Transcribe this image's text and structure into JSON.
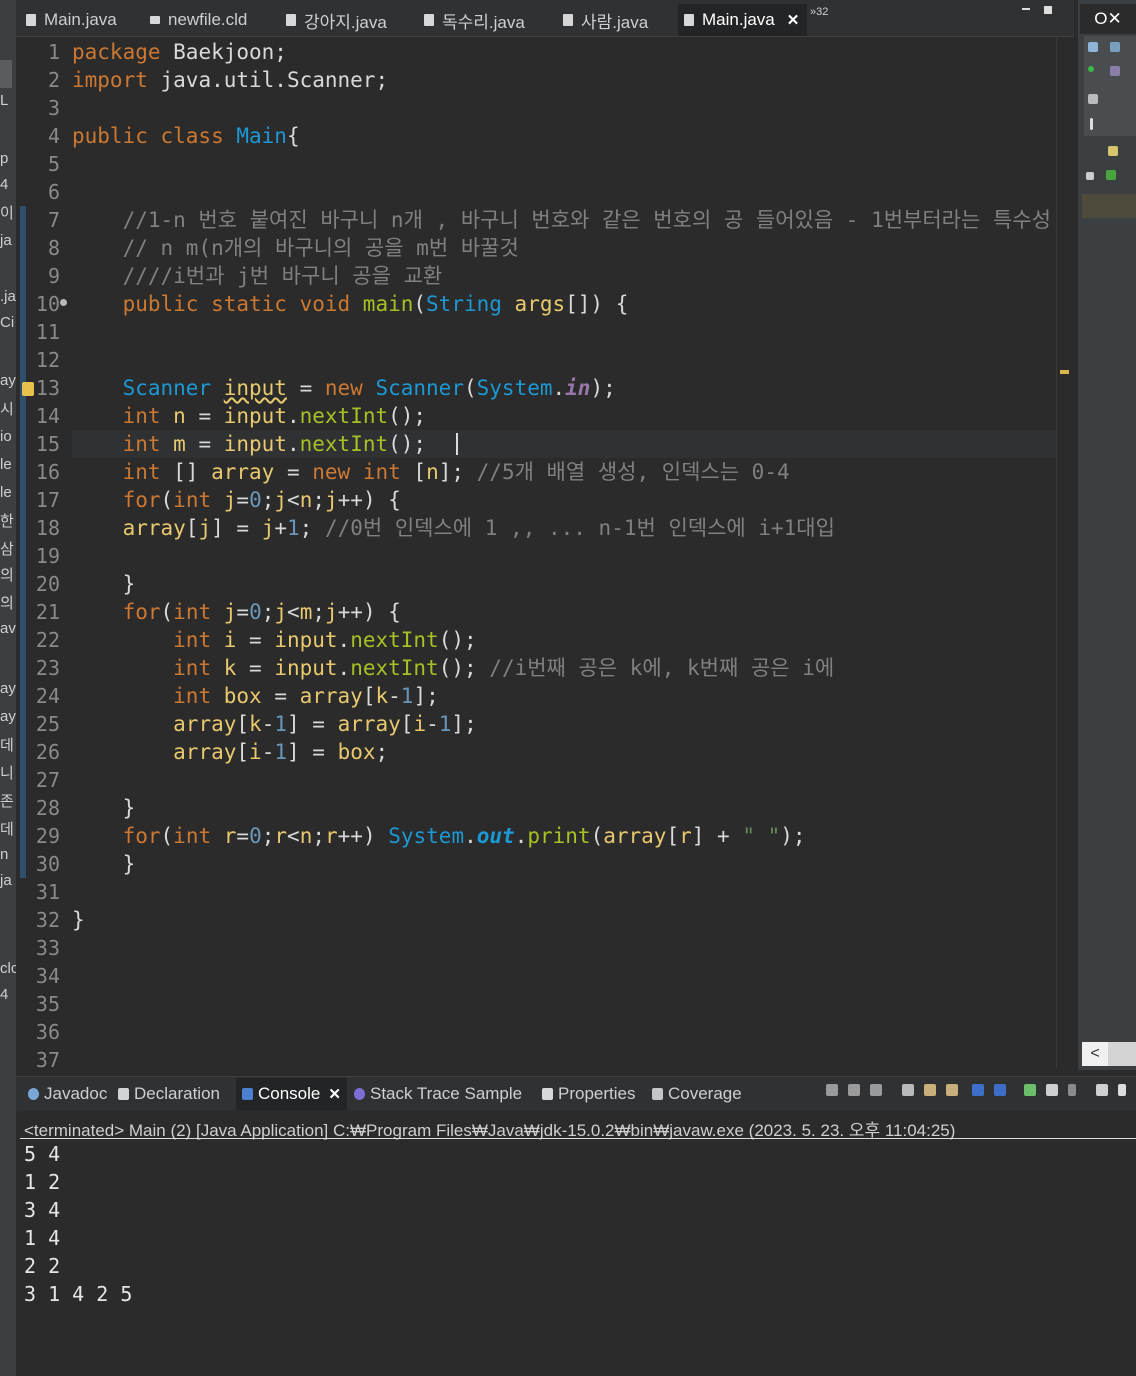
{
  "editor_tabs": [
    {
      "label": "Main.java",
      "icon": "java-file-icon",
      "active": false
    },
    {
      "label": "newfile.cld",
      "icon": "cld-file-icon",
      "active": false
    },
    {
      "label": "강아지.java",
      "icon": "java-file-icon",
      "active": false
    },
    {
      "label": "독수리.java",
      "icon": "java-file-icon",
      "active": false
    },
    {
      "label": "사람.java",
      "icon": "java-file-icon",
      "active": false
    },
    {
      "label": "Main.java",
      "icon": "java-file-icon",
      "active": true,
      "close": "✕"
    }
  ],
  "overflow_label": "»32",
  "right_panel_tab": "O✕",
  "left_fragments": [
    "L",
    "p",
    "4",
    "이",
    "ja",
    ".ja",
    "Ci",
    "ay",
    "시",
    "io",
    "le",
    "le",
    "한",
    "삼",
    "의",
    "의",
    "av",
    "ay",
    "ay",
    "데",
    "니",
    "존",
    "데",
    "n",
    "ja",
    "clc",
    "4"
  ],
  "code_lines": [
    {
      "n": "1",
      "t": [
        [
          "kw",
          "package "
        ],
        [
          "",
          "Baekjoon;"
        ]
      ]
    },
    {
      "n": "2",
      "t": [
        [
          "kw",
          "import "
        ],
        [
          "",
          "java.util.Scanner;"
        ]
      ]
    },
    {
      "n": "3",
      "t": []
    },
    {
      "n": "4",
      "t": [
        [
          "kw",
          "public class "
        ],
        [
          "typ",
          "Main"
        ],
        [
          "",
          "{"
        ]
      ]
    },
    {
      "n": "5",
      "t": []
    },
    {
      "n": "6",
      "t": []
    },
    {
      "n": "7",
      "t": [
        [
          "",
          "    "
        ],
        [
          "cm",
          "//1-n 번호 붙여진 바구니 n개 , 바구니 번호와 같은 번호의 공 들어있음 - 1번부터라는 특수성"
        ]
      ]
    },
    {
      "n": "8",
      "t": [
        [
          "",
          "    "
        ],
        [
          "cm",
          "// n m(n개의 바구니의 공을 m번 바꿀것"
        ]
      ]
    },
    {
      "n": "9",
      "t": [
        [
          "",
          "    "
        ],
        [
          "cm",
          "////i번과 j번 바구니 공을 교환"
        ]
      ]
    },
    {
      "n": "10",
      "t": [
        [
          "",
          "    "
        ],
        [
          "kw",
          "public static void "
        ],
        [
          "fn",
          "main"
        ],
        [
          "",
          "("
        ],
        [
          "typ",
          "String "
        ],
        [
          "var",
          "args"
        ],
        [
          "",
          "[]) {"
        ]
      ]
    },
    {
      "n": "11",
      "t": []
    },
    {
      "n": "12",
      "t": []
    },
    {
      "n": "13",
      "t": [
        [
          "",
          "    "
        ],
        [
          "typ",
          "Scanner "
        ],
        [
          "var wavy",
          "input"
        ],
        [
          "",
          " = "
        ],
        [
          "kw",
          "new "
        ],
        [
          "typ",
          "Scanner"
        ],
        [
          "",
          "("
        ],
        [
          "typ",
          "System"
        ],
        [
          "",
          "."
        ],
        [
          "fld",
          "in"
        ],
        [
          "",
          ");"
        ]
      ]
    },
    {
      "n": "14",
      "t": [
        [
          "",
          "    "
        ],
        [
          "kw",
          "int "
        ],
        [
          "var",
          "n"
        ],
        [
          "",
          " = "
        ],
        [
          "var",
          "input"
        ],
        [
          "",
          "."
        ],
        [
          "fn",
          "nextInt"
        ],
        [
          "",
          "();"
        ]
      ]
    },
    {
      "n": "15",
      "t": [
        [
          "",
          "    "
        ],
        [
          "kw",
          "int "
        ],
        [
          "var",
          "m"
        ],
        [
          "",
          " = "
        ],
        [
          "var",
          "input"
        ],
        [
          "",
          "."
        ],
        [
          "fn",
          "nextInt"
        ],
        [
          "",
          "();"
        ]
      ]
    },
    {
      "n": "16",
      "t": [
        [
          "",
          "    "
        ],
        [
          "kw",
          "int "
        ],
        [
          "",
          "[] "
        ],
        [
          "var",
          "array"
        ],
        [
          "",
          " = "
        ],
        [
          "kw",
          "new int "
        ],
        [
          "",
          "["
        ],
        [
          "var",
          "n"
        ],
        [
          "",
          "]; "
        ],
        [
          "cm",
          "//5개 배열 생성, 인덱스는 0-4"
        ]
      ]
    },
    {
      "n": "17",
      "t": [
        [
          "",
          "    "
        ],
        [
          "kw",
          "for"
        ],
        [
          "",
          "("
        ],
        [
          "kw",
          "int "
        ],
        [
          "var",
          "j"
        ],
        [
          "",
          "="
        ],
        [
          "num",
          "0"
        ],
        [
          "",
          ";"
        ],
        [
          "var",
          "j"
        ],
        [
          "",
          "<"
        ],
        [
          "var",
          "n"
        ],
        [
          "",
          ";"
        ],
        [
          "var",
          "j"
        ],
        [
          "",
          "++) {"
        ]
      ]
    },
    {
      "n": "18",
      "t": [
        [
          "",
          "    "
        ],
        [
          "var",
          "array"
        ],
        [
          "",
          "["
        ],
        [
          "var",
          "j"
        ],
        [
          "",
          "] = "
        ],
        [
          "var",
          "j"
        ],
        [
          "",
          "+"
        ],
        [
          "num",
          "1"
        ],
        [
          "",
          "; "
        ],
        [
          "cm",
          "//0번 인덱스에 1 ,, ... n-1번 인덱스에 i+1대입"
        ]
      ]
    },
    {
      "n": "19",
      "t": []
    },
    {
      "n": "20",
      "t": [
        [
          "",
          "    }"
        ]
      ]
    },
    {
      "n": "21",
      "t": [
        [
          "",
          "    "
        ],
        [
          "kw",
          "for"
        ],
        [
          "",
          "("
        ],
        [
          "kw",
          "int "
        ],
        [
          "var",
          "j"
        ],
        [
          "",
          "="
        ],
        [
          "num",
          "0"
        ],
        [
          "",
          ";"
        ],
        [
          "var",
          "j"
        ],
        [
          "",
          "<"
        ],
        [
          "var",
          "m"
        ],
        [
          "",
          ";"
        ],
        [
          "var",
          "j"
        ],
        [
          "",
          "++) {"
        ]
      ]
    },
    {
      "n": "22",
      "t": [
        [
          "",
          "        "
        ],
        [
          "kw",
          "int "
        ],
        [
          "var",
          "i"
        ],
        [
          "",
          " = "
        ],
        [
          "var",
          "input"
        ],
        [
          "",
          "."
        ],
        [
          "fn",
          "nextInt"
        ],
        [
          "",
          "();"
        ]
      ]
    },
    {
      "n": "23",
      "t": [
        [
          "",
          "        "
        ],
        [
          "kw",
          "int "
        ],
        [
          "var",
          "k"
        ],
        [
          "",
          " = "
        ],
        [
          "var",
          "input"
        ],
        [
          "",
          "."
        ],
        [
          "fn",
          "nextInt"
        ],
        [
          "",
          "(); "
        ],
        [
          "cm",
          "//i번째 공은 k에, k번째 공은 i에"
        ]
      ]
    },
    {
      "n": "24",
      "t": [
        [
          "",
          "        "
        ],
        [
          "kw",
          "int "
        ],
        [
          "var",
          "box"
        ],
        [
          "",
          " = "
        ],
        [
          "var",
          "array"
        ],
        [
          "",
          "["
        ],
        [
          "var",
          "k"
        ],
        [
          "",
          "-"
        ],
        [
          "num",
          "1"
        ],
        [
          "",
          "];"
        ]
      ]
    },
    {
      "n": "25",
      "t": [
        [
          "",
          "        "
        ],
        [
          "var",
          "array"
        ],
        [
          "",
          "["
        ],
        [
          "var",
          "k"
        ],
        [
          "",
          "-"
        ],
        [
          "num",
          "1"
        ],
        [
          "",
          "] = "
        ],
        [
          "var",
          "array"
        ],
        [
          "",
          "["
        ],
        [
          "var",
          "i"
        ],
        [
          "",
          "-"
        ],
        [
          "num",
          "1"
        ],
        [
          "",
          "];"
        ]
      ]
    },
    {
      "n": "26",
      "t": [
        [
          "",
          "        "
        ],
        [
          "var",
          "array"
        ],
        [
          "",
          "["
        ],
        [
          "var",
          "i"
        ],
        [
          "",
          "-"
        ],
        [
          "num",
          "1"
        ],
        [
          "",
          "] = "
        ],
        [
          "var",
          "box"
        ],
        [
          "",
          ";"
        ]
      ]
    },
    {
      "n": "27",
      "t": []
    },
    {
      "n": "28",
      "t": [
        [
          "",
          "    }"
        ]
      ]
    },
    {
      "n": "29",
      "t": [
        [
          "",
          "    "
        ],
        [
          "kw",
          "for"
        ],
        [
          "",
          "("
        ],
        [
          "kw",
          "int "
        ],
        [
          "var",
          "r"
        ],
        [
          "",
          "="
        ],
        [
          "num",
          "0"
        ],
        [
          "",
          ";"
        ],
        [
          "var",
          "r"
        ],
        [
          "",
          "<"
        ],
        [
          "var",
          "n"
        ],
        [
          "",
          ";"
        ],
        [
          "var",
          "r"
        ],
        [
          "",
          "++) "
        ],
        [
          "typ",
          "System"
        ],
        [
          "",
          "."
        ],
        [
          "flds",
          "out"
        ],
        [
          "",
          "."
        ],
        [
          "fn",
          "print"
        ],
        [
          "",
          "("
        ],
        [
          "var",
          "array"
        ],
        [
          "",
          "["
        ],
        [
          "var",
          "r"
        ],
        [
          "",
          "] + "
        ],
        [
          "str",
          "\" \""
        ],
        [
          "",
          ");"
        ]
      ]
    },
    {
      "n": "30",
      "t": [
        [
          "",
          "    }"
        ]
      ]
    },
    {
      "n": "31",
      "t": []
    },
    {
      "n": "32",
      "t": [
        [
          "",
          "}"
        ]
      ]
    },
    {
      "n": "33",
      "t": []
    },
    {
      "n": "34",
      "t": []
    },
    {
      "n": "35",
      "t": []
    },
    {
      "n": "36",
      "t": []
    },
    {
      "n": "37",
      "t": []
    }
  ],
  "bottom_tabs": [
    {
      "label": "Javadoc",
      "icon": "javadoc-icon",
      "active": false
    },
    {
      "label": "Declaration",
      "icon": "declaration-icon",
      "active": false
    },
    {
      "label": "Console",
      "icon": "console-icon",
      "active": true,
      "close": "✕"
    },
    {
      "label": "Stack Trace Sample",
      "icon": "stack-trace-icon",
      "active": false
    },
    {
      "label": "Properties",
      "icon": "properties-icon",
      "active": false
    },
    {
      "label": "Coverage",
      "icon": "coverage-icon",
      "active": false
    }
  ],
  "console": {
    "header": "<terminated> Main (2) [Java Application] C:₩Program Files₩Java₩jdk-15.0.2₩bin₩javaw.exe  (2023. 5. 23. 오후 11:04:25)",
    "lines": [
      "5 4",
      "1 2",
      "3 4",
      "1 4",
      "2 2",
      "3 1 4 2 5"
    ]
  },
  "colors": {
    "keyword": "#cc7832",
    "type": "#1c98d4",
    "variable": "#e8c96e",
    "method": "#a8c023",
    "number": "#6897bb",
    "comment": "#808080",
    "background": "#2b2b2b"
  }
}
